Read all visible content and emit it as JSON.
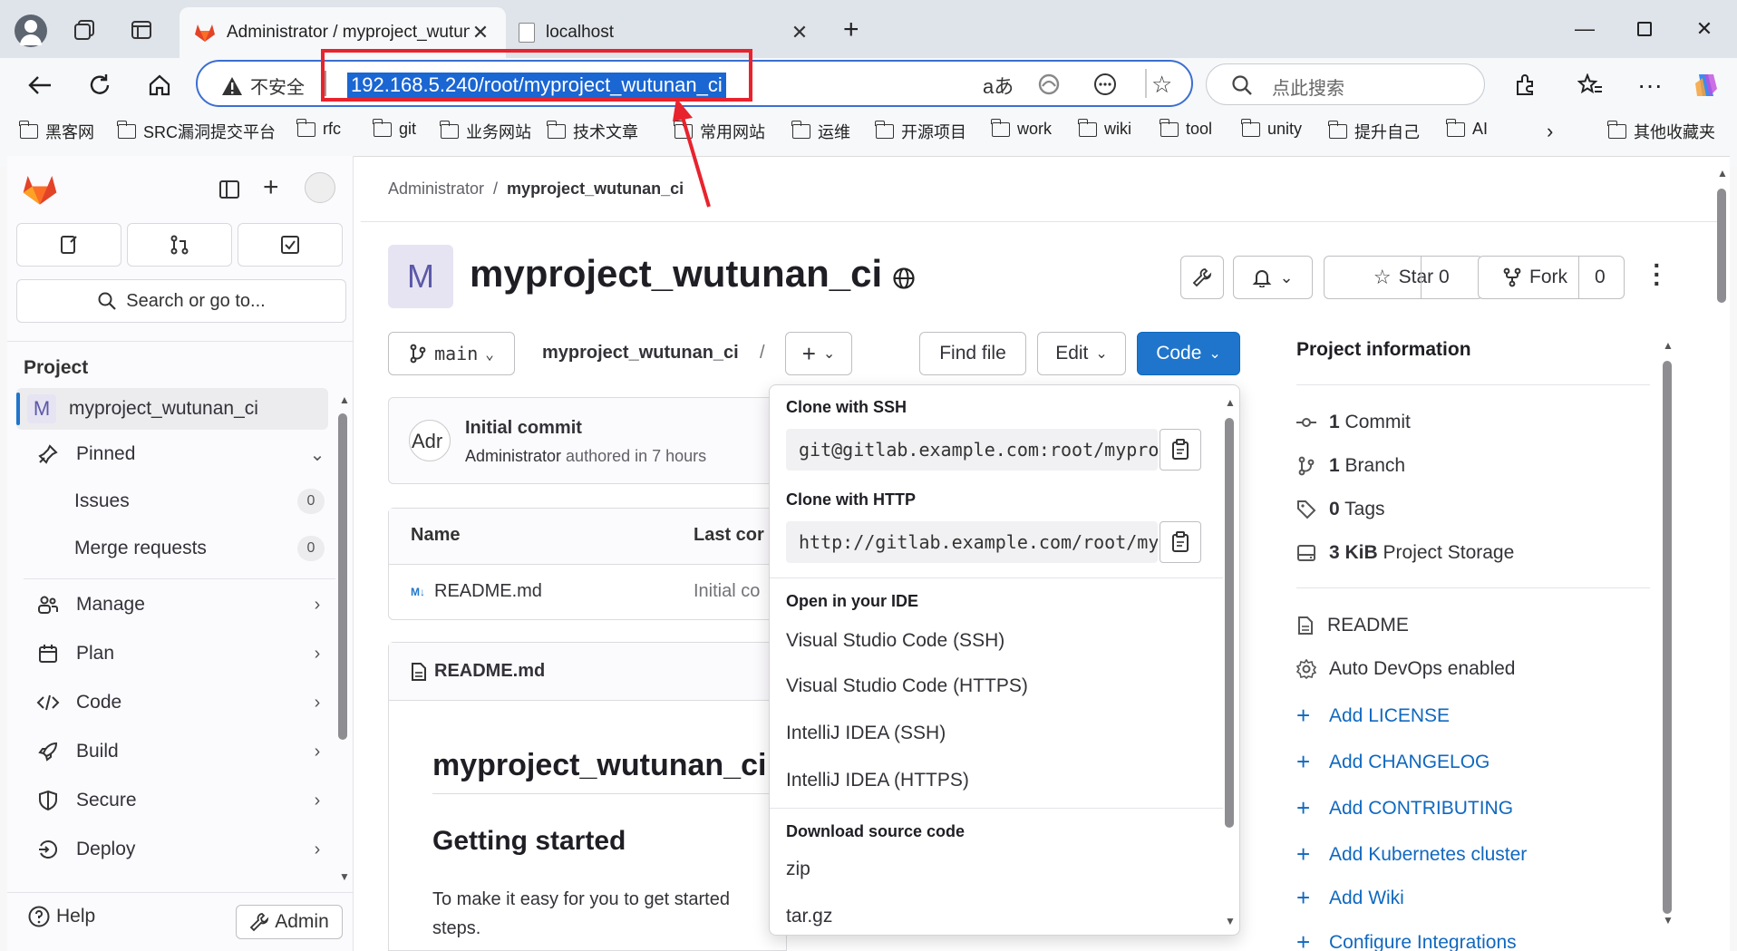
{
  "browser": {
    "tabs": [
      {
        "title": "Administrator / myproject_wutuna",
        "active": true
      },
      {
        "title": "localhost",
        "active": false
      }
    ],
    "address": {
      "security_label": "不安全",
      "url": "192.168.5.240/root/myproject_wutunan_ci"
    },
    "search_placeholder": "点此搜索",
    "bookmarks": [
      "黑客网",
      "SRC漏洞提交平台",
      "rfc",
      "git",
      "业务网站",
      "技术文章",
      "常用网站",
      "运维",
      "开源项目",
      "work",
      "wiki",
      "tool",
      "unity",
      "提升自己",
      "AI",
      "其他收藏夹"
    ]
  },
  "sidebar": {
    "search_label": "Search or go to...",
    "section_title": "Project",
    "project_avatar": "M",
    "project_name": "myproject_wutunan_ci",
    "pinned": "Pinned",
    "issues": {
      "label": "Issues",
      "count": "0"
    },
    "merge_requests": {
      "label": "Merge requests",
      "count": "0"
    },
    "nav": [
      "Manage",
      "Plan",
      "Code",
      "Build",
      "Secure",
      "Deploy"
    ],
    "help": "Help",
    "admin": "Admin"
  },
  "breadcrumb": {
    "parent": "Administrator",
    "separator": "/",
    "current": "myproject_wutunan_ci"
  },
  "project": {
    "avatar": "M",
    "title": "myproject_wutunan_ci",
    "star_label": "Star",
    "star_count": "0",
    "fork_label": "Fork",
    "fork_count": "0"
  },
  "repo_bar": {
    "branch": "main",
    "path": "myproject_wutunan_ci",
    "path_sep": "/",
    "find_file": "Find file",
    "edit": "Edit",
    "code": "Code"
  },
  "commit": {
    "message": "Initial commit",
    "author": "Administrator",
    "meta": "authored in 7 hours",
    "avatar_alt": "Adr"
  },
  "file_table": {
    "headers": [
      "Name",
      "Last cor"
    ],
    "rows": [
      {
        "name": "README.md",
        "last_commit": "Initial co"
      }
    ]
  },
  "readme": {
    "file_label": "README.md",
    "h1": "myproject_wutunan_ci",
    "h2": "Getting started",
    "para_line1": "To make it easy for you to get started",
    "para_line2": "steps."
  },
  "clone_dropdown": {
    "ssh_title": "Clone with SSH",
    "ssh_url": "git@gitlab.example.com:root/myproject_wutunan_ci.git",
    "http_title": "Clone with HTTP",
    "http_url": "http://gitlab.example.com/root/myproject_wutunan_ci.git",
    "ide_title": "Open in your IDE",
    "ide_items": [
      "Visual Studio Code (SSH)",
      "Visual Studio Code (HTTPS)",
      "IntelliJ IDEA (SSH)",
      "IntelliJ IDEA (HTTPS)"
    ],
    "download_title": "Download source code",
    "download_items": [
      "zip",
      "tar.gz"
    ]
  },
  "project_info": {
    "title": "Project information",
    "stats": [
      {
        "value": "1",
        "label": "Commit"
      },
      {
        "value": "1",
        "label": "Branch"
      },
      {
        "value": "0",
        "label": "Tags"
      },
      {
        "value": "3 KiB",
        "label": "Project Storage"
      }
    ],
    "readme": "README",
    "auto_devops": "Auto DevOps enabled",
    "add_links": [
      "Add LICENSE",
      "Add CHANGELOG",
      "Add CONTRIBUTING",
      "Add Kubernetes cluster",
      "Add Wiki",
      "Configure Integrations"
    ]
  },
  "colors": {
    "accent": "#1f75cb",
    "annotation": "#e8232d",
    "link": "#1068bf"
  }
}
